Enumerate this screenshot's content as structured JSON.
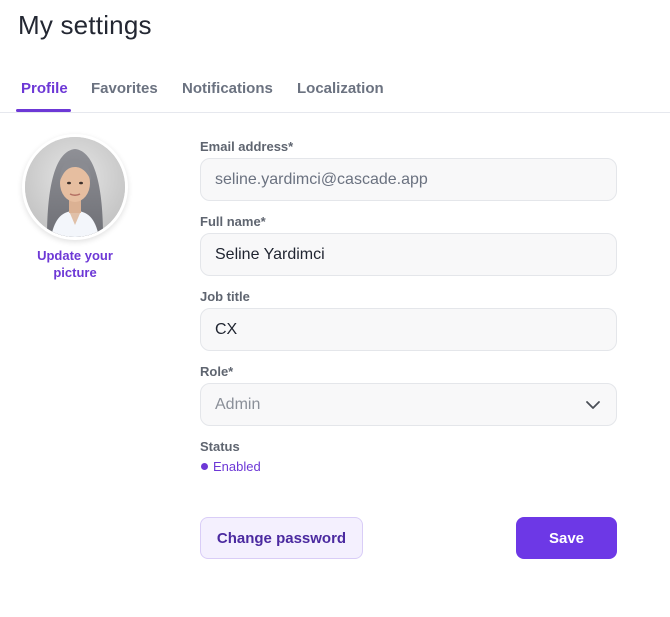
{
  "page": {
    "title": "My settings"
  },
  "tabs": [
    {
      "label": "Profile",
      "active": true
    },
    {
      "label": "Favorites",
      "active": false
    },
    {
      "label": "Notifications",
      "active": false
    },
    {
      "label": "Localization",
      "active": false
    }
  ],
  "profile": {
    "update_picture_label": "Update your picture"
  },
  "form": {
    "email": {
      "label": "Email address*",
      "value": "seline.yardimci@cascade.app"
    },
    "full_name": {
      "label": "Full name*",
      "value": "Seline Yardimci"
    },
    "job_title": {
      "label": "Job title",
      "value": "CX"
    },
    "role": {
      "label": "Role*",
      "value": "Admin",
      "icon": "chevron-down-icon"
    },
    "status": {
      "label": "Status",
      "value": "Enabled"
    }
  },
  "actions": {
    "change_password_label": "Change password",
    "save_label": "Save"
  },
  "colors": {
    "accent": "#6d38d6",
    "primary_button": "#6d38e6",
    "secondary_button_bg": "#f4f0fe"
  }
}
